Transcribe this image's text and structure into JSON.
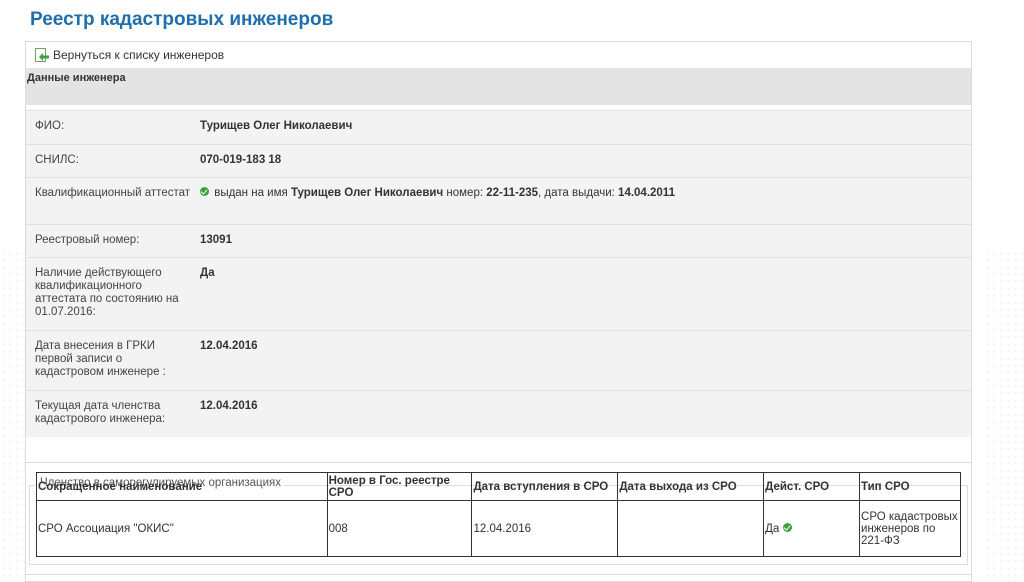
{
  "page": {
    "title": "Реестр кадастровых инженеров",
    "back_link": "Вернуться к списку инженеров"
  },
  "section": {
    "title": "Данные инженера"
  },
  "fields": {
    "fio": {
      "label": "ФИО:",
      "value": "Турищев Олег Николаевич"
    },
    "snils": {
      "label": "СНИЛС:",
      "value": "070-019-183 18"
    },
    "certificate": {
      "label": "Квалификационный аттестат",
      "prefix": "выдан на имя",
      "name": "Турищев Олег Николаевич",
      "number_label": "номер:",
      "number": "22-11-235",
      "date_label": ", дата выдачи:",
      "date": "14.04.2011"
    },
    "registry_number": {
      "label": "Реестровый номер:",
      "value": "13091"
    },
    "valid_certificate": {
      "label": "Наличие действующего квалификационного аттестата по состоянию на 01.07.2016:",
      "value": "Да"
    },
    "grki_date": {
      "label": "Дата внесения в ГРКИ первой записи о кадастровом инженере :",
      "value": "12.04.2016"
    },
    "membership_date": {
      "label": "Текущая дата членства кадастрового инженера:",
      "value": "12.04.2016"
    }
  },
  "membership": {
    "legend": "Членство в саморегулируемых организациях",
    "columns": [
      "Сокращенное наименование",
      "Номер в Гос. реестре СРО",
      "Дата вступления в СРО",
      "Дата выхода из СРО",
      "Дейст. СРО",
      "Тип СРО"
    ],
    "rows": [
      {
        "name": "СРО Ассоциация \"ОКИС\"",
        "number": "008",
        "join_date": "12.04.2016",
        "exit_date": "",
        "active": "Да",
        "type": "СРО кадастровых инженеров по 221-ФЗ"
      }
    ]
  },
  "colors": {
    "title": "#1f6fad",
    "ok": "#3ba33b",
    "header_bg": "#e4e4e4",
    "row_bg": "#f3f3f3"
  },
  "icons": {
    "back": "back-arrow-document-icon",
    "ok": "check-circle-icon"
  }
}
